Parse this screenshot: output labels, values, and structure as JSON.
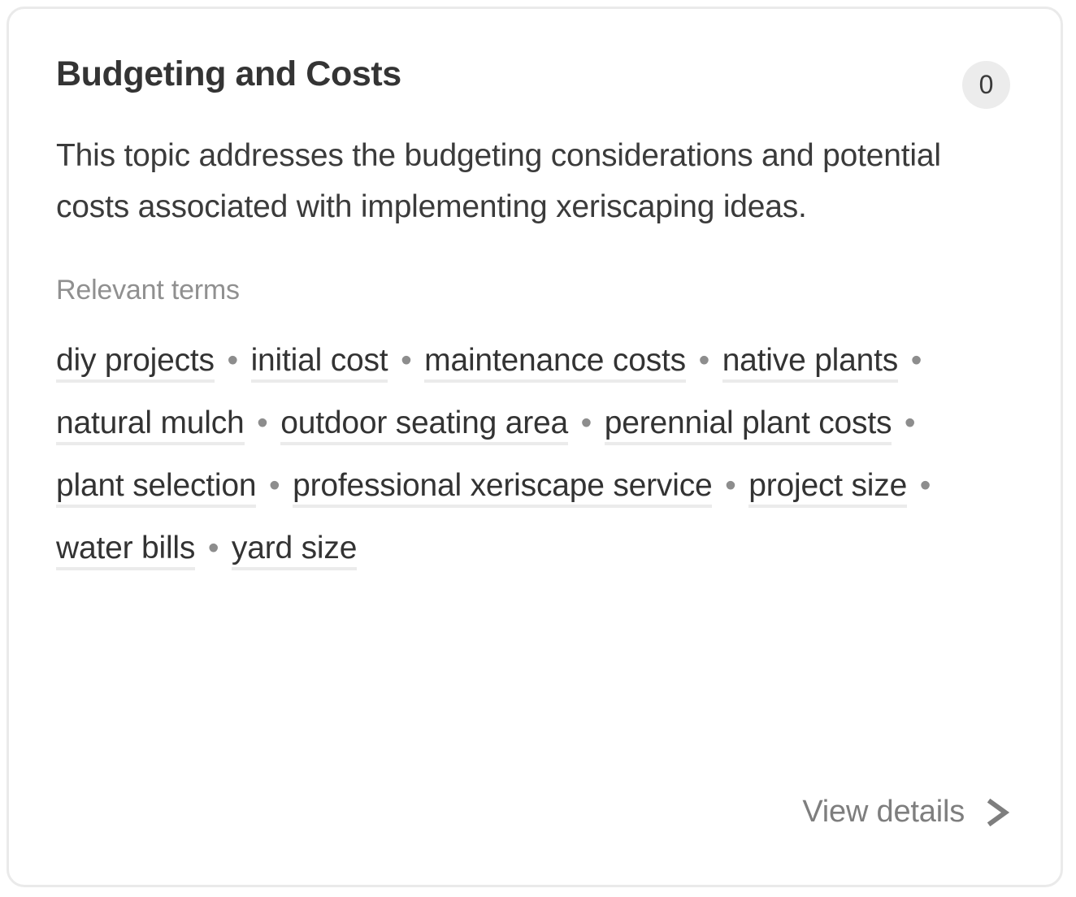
{
  "card": {
    "title": "Budgeting and Costs",
    "badge_count": "0",
    "description": "This topic addresses the budgeting considerations and potential costs associated with implementing xeriscaping ideas.",
    "terms_label": "Relevant terms",
    "term_separator": "•",
    "terms": [
      "diy projects",
      "initial cost",
      "maintenance costs",
      "native plants",
      "natural mulch",
      "outdoor seating area",
      "perennial plant costs",
      "plant selection",
      "professional xeriscape service",
      "project size",
      "water bills",
      "yard size"
    ],
    "footer": {
      "view_details_label": "View details",
      "chevron_icon": "chevron-right-icon"
    },
    "colors": {
      "card_border": "#eaeaea",
      "title": "#343434",
      "body_text": "#3b3b3b",
      "muted_text": "#909090",
      "badge_bg": "#ececec",
      "term_underline": "#ebebeb",
      "footer_text": "#7e7e7e"
    }
  }
}
